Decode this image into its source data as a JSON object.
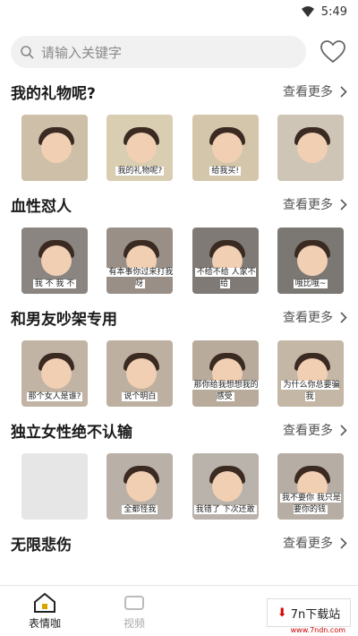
{
  "status": {
    "time": "5:49"
  },
  "search": {
    "placeholder": "请输入关键字"
  },
  "sections": [
    {
      "title": "我的礼物呢?",
      "more": "查看更多",
      "thumbs": [
        {
          "cap": ""
        },
        {
          "cap": "我的礼物呢?"
        },
        {
          "cap": "给我买!"
        },
        {
          "cap": ""
        }
      ],
      "bg": [
        "#cdbfa8",
        "#d9cdb2",
        "#d3c6aa",
        "#cfc5b6"
      ]
    },
    {
      "title": "血性怼人",
      "more": "查看更多",
      "thumbs": [
        {
          "cap": "我 不 我 不"
        },
        {
          "cap": "有本事你过来打我呀"
        },
        {
          "cap": "不给不给 人家不给"
        },
        {
          "cap": "哦比哦~"
        }
      ],
      "bg": [
        "#8a8580",
        "#9a8f86",
        "#7f7a76",
        "#7b7773"
      ]
    },
    {
      "title": "和男友吵架专用",
      "more": "查看更多",
      "thumbs": [
        {
          "cap": "那个女人是谁?"
        },
        {
          "cap": "说个明白"
        },
        {
          "cap": "那你给我想想我的感受"
        },
        {
          "cap": "为什么你总要骗我"
        }
      ],
      "bg": [
        "#c2b4a4",
        "#bdb0a0",
        "#b8ab9c",
        "#c4b7a6"
      ]
    },
    {
      "title": "独立女性绝不认输",
      "more": "查看更多",
      "thumbs": [
        {
          "cap": ""
        },
        {
          "cap": "全都怪我"
        },
        {
          "cap": "我错了 下次还敢"
        },
        {
          "cap": "我不要你 我只是要你的钱"
        }
      ],
      "bg": [
        "#e6e6e6",
        "#b9b1a8",
        "#bab3ab",
        "#b6aea4"
      ]
    },
    {
      "title": "无限悲伤",
      "more": "查看更多",
      "thumbs": [],
      "bg": []
    }
  ],
  "nav": {
    "home": "表情咖",
    "video": "视频"
  },
  "watermark": {
    "brand": "7n下载站",
    "url": "www.7ndn.com"
  },
  "colors": {
    "accent": "#d9a400",
    "text": "#1a1a1a",
    "muted": "#8a8a8a"
  }
}
